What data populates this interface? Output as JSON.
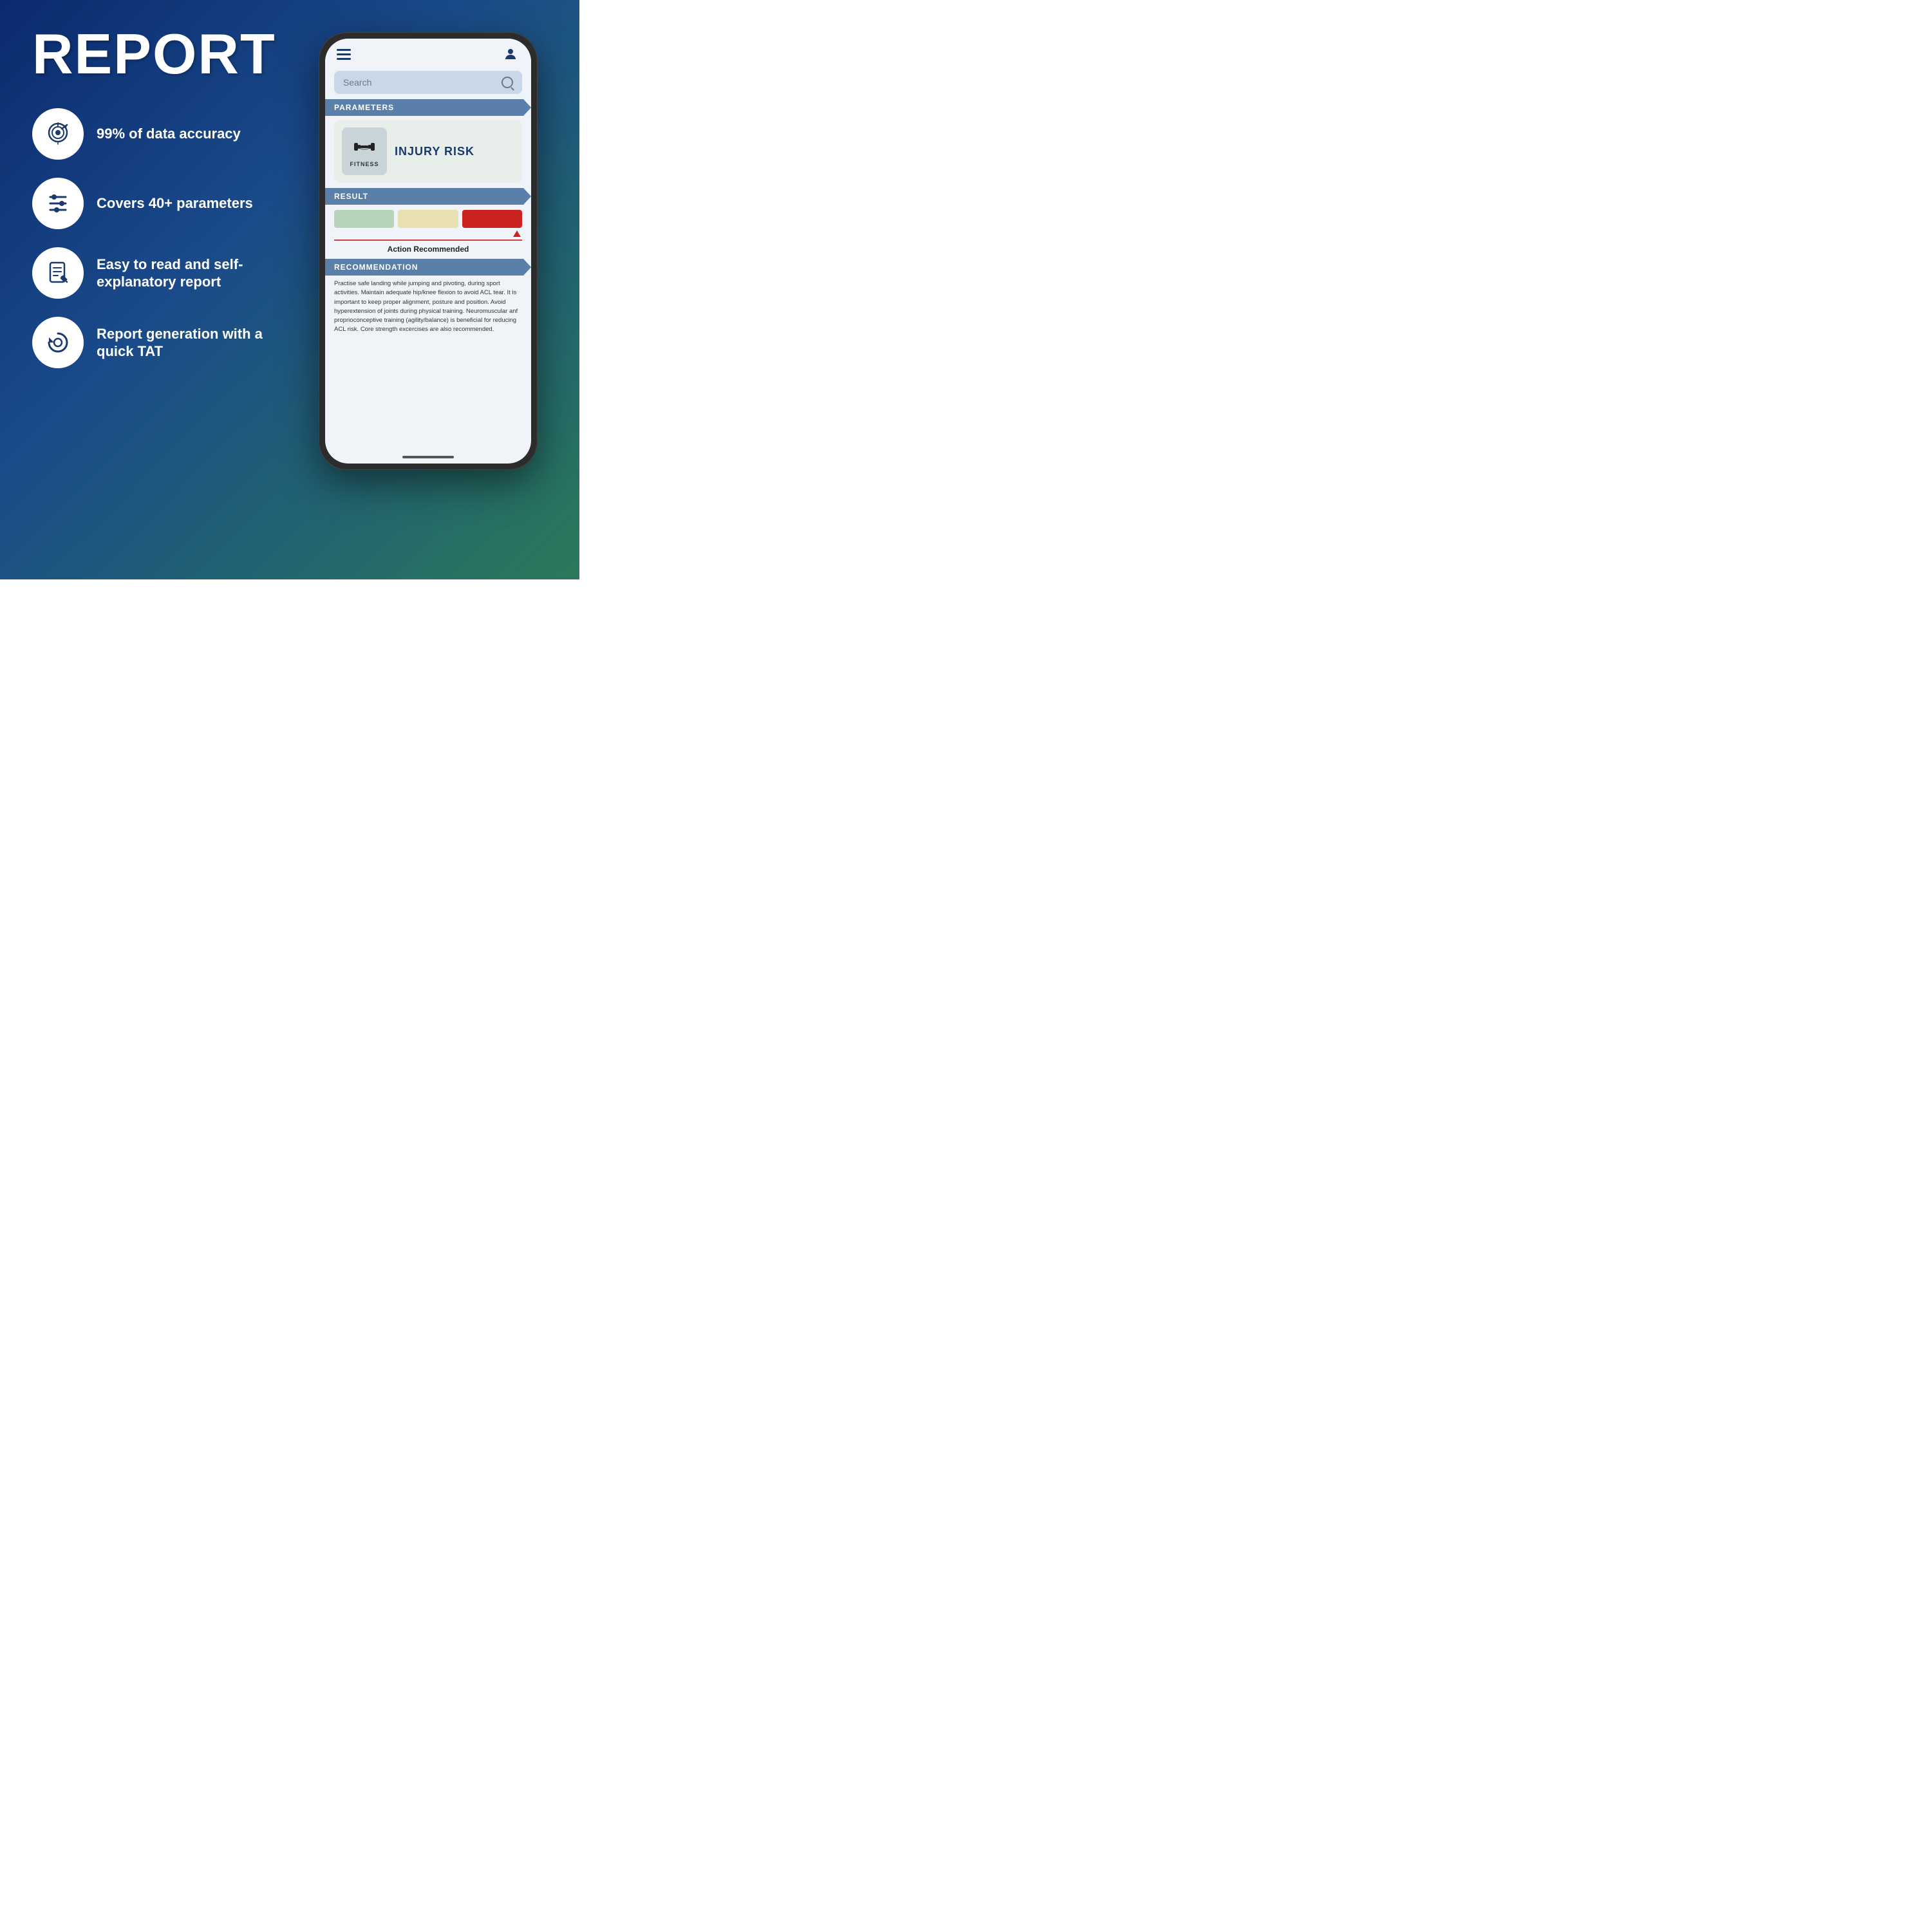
{
  "page": {
    "title": "REPORT",
    "bg_gradient_start": "#0a2a6e",
    "bg_gradient_end": "#2a7a5a"
  },
  "features": [
    {
      "id": "accuracy",
      "icon": "target-icon",
      "text": "99% of data accuracy"
    },
    {
      "id": "parameters",
      "icon": "sliders-icon",
      "text": "Covers 40+ parameters"
    },
    {
      "id": "report",
      "icon": "document-icon",
      "text": "Easy to read and self-explanatory report"
    },
    {
      "id": "tat",
      "icon": "refresh-icon",
      "text": "Report generation with a quick TAT"
    }
  ],
  "phone": {
    "search_placeholder": "Search",
    "sections": {
      "parameters": "PARAMETERS",
      "result": "RESULT",
      "recommendation": "RECOMMENDATION"
    },
    "injury_risk_label": "INJURY RISK",
    "fitness_label": "FITNESS",
    "action_label": "Action Recommended",
    "recommendation_text": "Practise safe landing while jumping and pivoting, during sport activities. Maintain adequate hip/knee flexion to avoid ACL tear. It is important to keep proper alignment, posture and position. Avoid hyperextension of joints during physical training. Neuromuscular anf proprioconceptive training (agility/balance) is beneficial for reducing ACL risk. Core strength excercises are also recommended."
  }
}
